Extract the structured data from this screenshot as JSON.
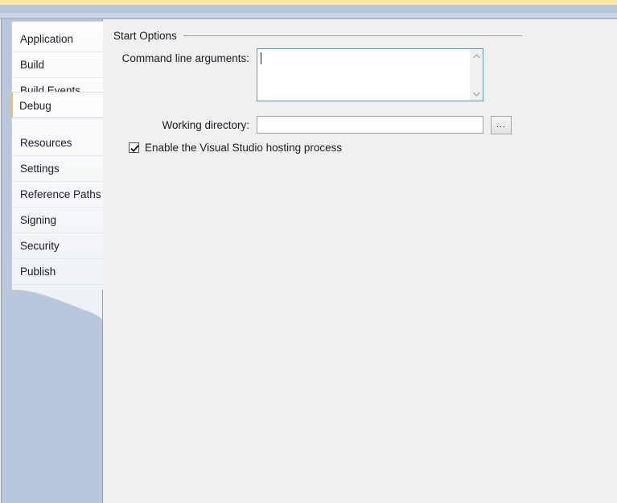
{
  "window": {
    "accent_yellow": "#fce6a4",
    "chrome_blue": "#b9c7dc",
    "content_bg": "#f0f0f0"
  },
  "sidebar": {
    "selected": "Debug",
    "accent_color": "#f3c15c",
    "items": [
      {
        "label": "Application"
      },
      {
        "label": "Build"
      },
      {
        "label": "Build Events"
      },
      {
        "label": "Debug"
      },
      {
        "label": "Resources"
      },
      {
        "label": "Settings"
      },
      {
        "label": "Reference Paths"
      },
      {
        "label": "Signing"
      },
      {
        "label": "Security"
      },
      {
        "label": "Publish"
      }
    ]
  },
  "main": {
    "group_title": "Start Options",
    "command_line_arguments": {
      "label": "Command line arguments:",
      "value": "",
      "scroll_up_icon": "chevron-up-icon",
      "scroll_down_icon": "chevron-down-icon"
    },
    "working_directory": {
      "label": "Working directory:",
      "value": "",
      "placeholder": "",
      "browse_label": "..."
    },
    "hosting_process": {
      "label": "Enable the Visual Studio hosting process",
      "checked": true,
      "check_icon": "checkmark-icon"
    }
  }
}
